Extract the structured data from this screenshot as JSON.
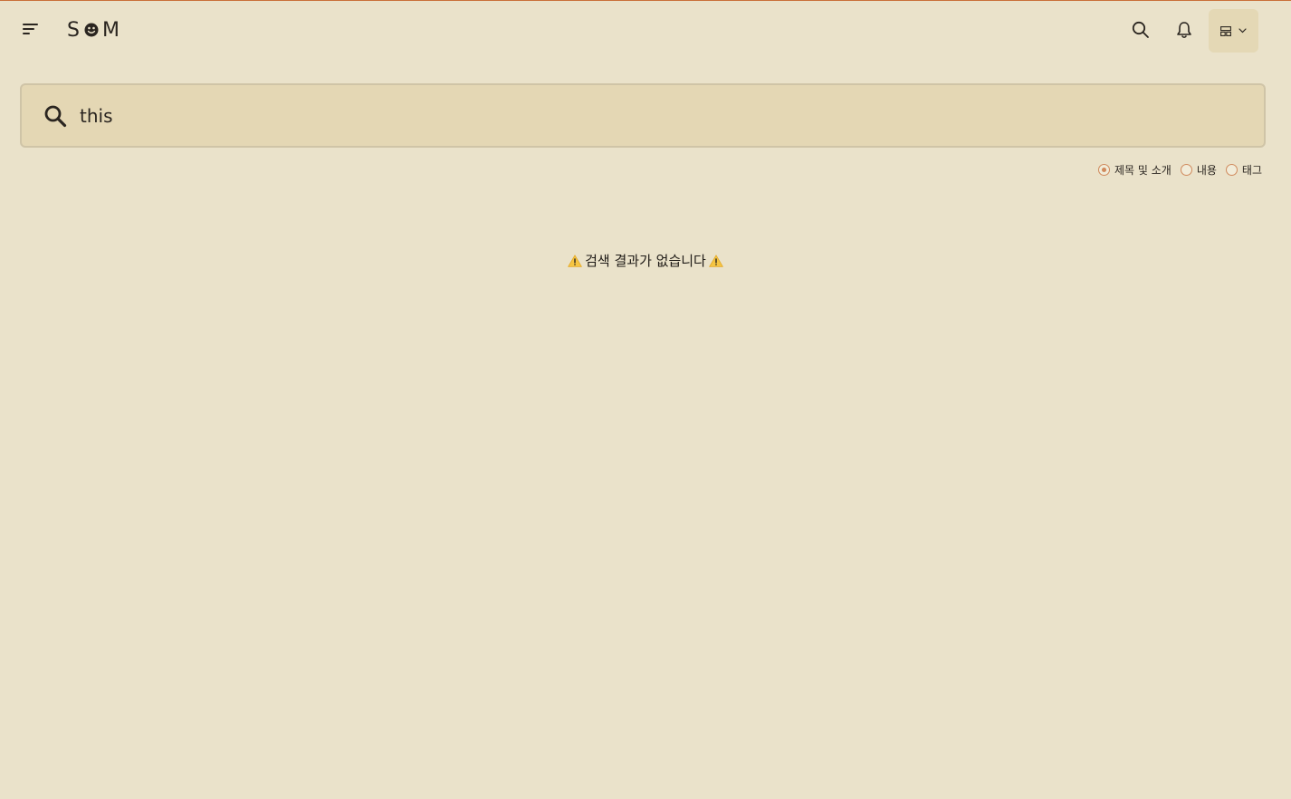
{
  "header": {
    "logo_left": "S",
    "logo_right": "M"
  },
  "search": {
    "value": "this",
    "placeholder": ""
  },
  "filters": {
    "options": [
      "제목 및 소개",
      "내용",
      "태그"
    ],
    "selected_index": 0
  },
  "results": {
    "empty_message": "검색 결과가 없습니다"
  },
  "icons": {
    "menu": "menu-icon",
    "search": "search-icon",
    "bell": "bell-icon",
    "account": "grid-icon",
    "chevron": "chevron-down-icon",
    "warning": "warning-icon"
  },
  "colors": {
    "background": "#EAE2CA",
    "search_field": "#E4D7B4",
    "accent": "#D08A5C",
    "warning": "#F5C542"
  }
}
